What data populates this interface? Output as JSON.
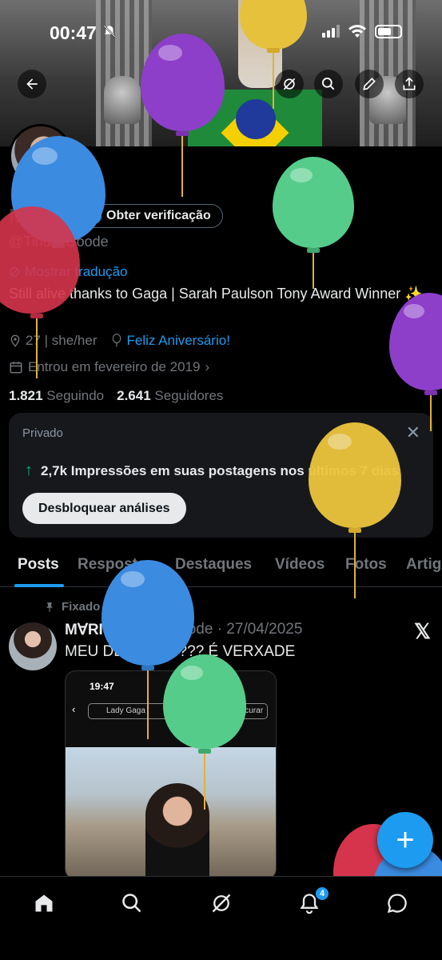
{
  "status_bar": {
    "time": "00:47"
  },
  "profile": {
    "name": "M∀RI",
    "verify_label": "Obter verificação",
    "handle": "@TindallGoode",
    "translate_label": "Mostrar tradução",
    "bio": "Still alive thanks to Gaga | Sarah Paulson Tony Award Winner ✨",
    "age_pronouns": "27 | she/her",
    "birthday_link": "Feliz Aniversário!",
    "joined": "Entrou em fevereiro de 2019",
    "following_count": "1.821",
    "following_label": "Seguindo",
    "followers_count": "2.641",
    "followers_label": "Seguidores"
  },
  "analytics_card": {
    "label": "Privado",
    "impressions": "2,7k Impressões em suas postagens nos últimos 7 dias",
    "unlock_label": "Desbloquear análises"
  },
  "tabs": [
    {
      "label": "Posts"
    },
    {
      "label": "Respostas"
    },
    {
      "label": "Destaques"
    },
    {
      "label": "Vídeos"
    },
    {
      "label": "Fotos"
    },
    {
      "label": "Artigos"
    }
  ],
  "post": {
    "pinned_label": "Fixado",
    "author": "M∀RI",
    "handle_date": "@TindallGoode · 27/04/2025",
    "text": "MEU DEUS??????? É VERXADE",
    "media": {
      "time": "19:47",
      "search_text": "Lady Gaga",
      "search_button": "Procurar"
    }
  },
  "bottom_nav": {
    "notifications_badge": "4"
  },
  "colors": {
    "accent": "#1d9bf0",
    "background": "#000000",
    "card": "#16181c",
    "positive": "#00ba7c"
  },
  "icons": [
    "back-arrow-icon",
    "grok-icon",
    "search-icon",
    "pen-icon",
    "share-icon",
    "verified-badge-icon",
    "location-icon",
    "balloon-icon",
    "calendar-icon",
    "pin-icon",
    "x-logo-icon",
    "home-icon",
    "notifications-icon",
    "messages-icon",
    "plus-icon"
  ]
}
